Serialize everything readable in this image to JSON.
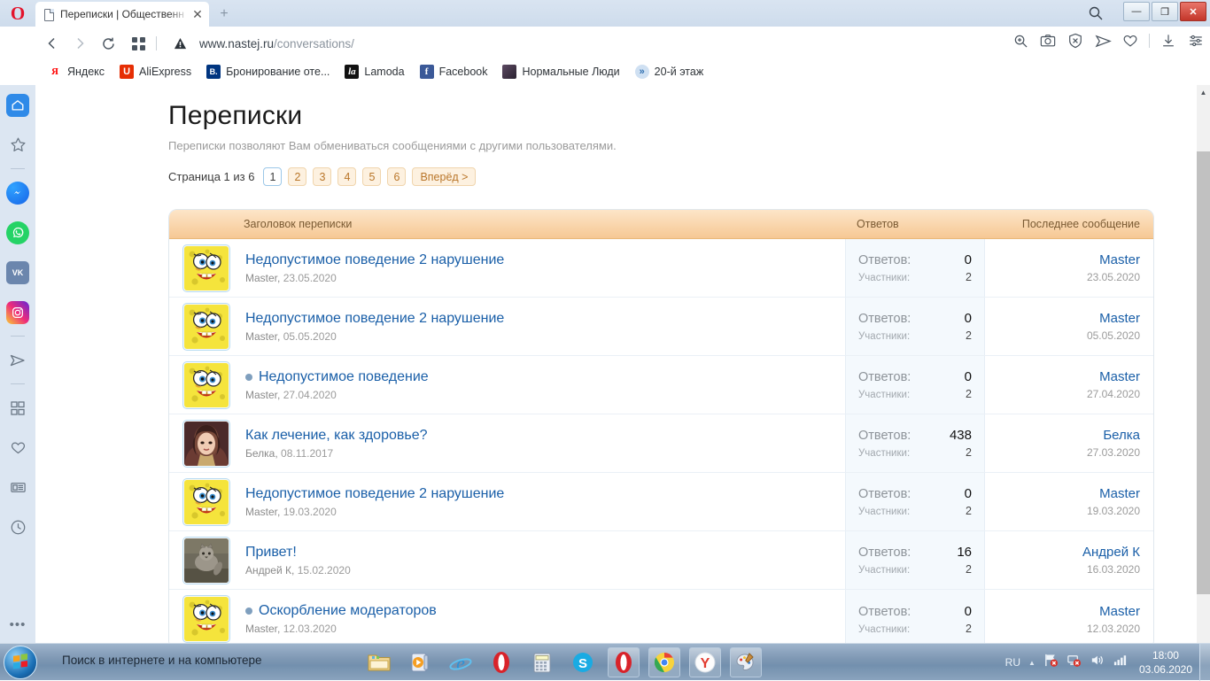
{
  "browser": {
    "name": "Opera",
    "tab": {
      "title": "Переписки | Общественн",
      "close_label": "✕"
    },
    "new_tab_label": "+",
    "address": {
      "url_prefix": "www.nastej.ru",
      "url_path": "/conversations/"
    },
    "nav": {
      "back": "‹",
      "forward": "›",
      "reload": "⟳",
      "speeddial": "⊞"
    },
    "window_controls": {
      "minimize": "—",
      "restore": "❐",
      "close": "✕"
    },
    "toolbar_icons": [
      "zoom-icon",
      "snapshot-icon",
      "adblock-shield-icon",
      "send-icon",
      "heart-icon",
      "download-icon",
      "easy-setup-icon"
    ],
    "bookmarks": [
      {
        "label": "Яндекс",
        "glyph": "Я",
        "color": "#ffffff",
        "text_color": "#ff0000"
      },
      {
        "label": "AliExpress",
        "glyph": "U",
        "color": "#e62e04",
        "text_color": "#ffffff"
      },
      {
        "label": "Бронирование оте...",
        "glyph": "B.",
        "color": "#003580",
        "text_color": "#ffffff"
      },
      {
        "label": "Lamoda",
        "glyph": "la",
        "color": "#111111",
        "text_color": "#ffffff"
      },
      {
        "label": "Facebook",
        "glyph": "f",
        "color": "#3b5998",
        "text_color": "#ffffff"
      },
      {
        "label": "Нормальные Люди",
        "glyph": "",
        "color": "#4a3a52",
        "text_color": "#ffffff"
      },
      {
        "label": "20-й этаж",
        "glyph": "»",
        "color": "#cfe0f2",
        "text_color": "#2f6fb0"
      }
    ],
    "sidebar_items": [
      {
        "name": "home",
        "label": "Главная",
        "active": true
      },
      {
        "name": "favorites",
        "label": "Закладки",
        "active": false
      },
      {
        "name": "messenger",
        "label": "Messenger",
        "active": false
      },
      {
        "name": "whatsapp",
        "label": "WhatsApp",
        "active": false
      },
      {
        "name": "vk",
        "label": "ВКонтакте",
        "active": false
      },
      {
        "name": "instagram",
        "label": "Instagram",
        "active": false
      },
      {
        "name": "telegram",
        "label": "Telegram",
        "active": false
      },
      {
        "name": "speed-dial",
        "label": "Экспресс-панель",
        "active": false
      },
      {
        "name": "heart",
        "label": "Избранное",
        "active": false
      },
      {
        "name": "news",
        "label": "Новости",
        "active": false
      },
      {
        "name": "history",
        "label": "История",
        "active": false
      },
      {
        "name": "more",
        "label": "Ещё",
        "active": false
      }
    ]
  },
  "page": {
    "title": "Переписки",
    "subtitle": "Переписки позволяют Вам обмениваться сообщениями с другими пользователями.",
    "pagination": {
      "label": "Страница 1 из 6",
      "pages": [
        "1",
        "2",
        "3",
        "4",
        "5",
        "6"
      ],
      "current": "1",
      "next_label": "Вперёд >"
    },
    "table": {
      "headers": {
        "title": "Заголовок переписки",
        "replies": "Ответов",
        "last": "Последнее сообщение"
      },
      "row_labels": {
        "replies": "Ответов:",
        "participants": "Участники:"
      },
      "rows": [
        {
          "avatar": "spongebob",
          "unread": false,
          "title": "Недопустимое поведение 2 нарушение",
          "author": "Master",
          "date": "23.05.2020",
          "replies": "0",
          "participants": "2",
          "last_user": "Master",
          "last_date": "23.05.2020"
        },
        {
          "avatar": "spongebob",
          "unread": false,
          "title": "Недопустимое поведение 2 нарушение",
          "author": "Master",
          "date": "05.05.2020",
          "replies": "0",
          "participants": "2",
          "last_user": "Master",
          "last_date": "05.05.2020"
        },
        {
          "avatar": "spongebob",
          "unread": true,
          "title": "Недопустимое поведение",
          "author": "Master",
          "date": "27.04.2020",
          "replies": "0",
          "participants": "2",
          "last_user": "Master",
          "last_date": "27.04.2020"
        },
        {
          "avatar": "girl",
          "unread": false,
          "title": "Как лечение, как здоровье?",
          "author": "Белка",
          "date": "08.11.2017",
          "replies": "438",
          "participants": "2",
          "last_user": "Белка",
          "last_date": "27.03.2020"
        },
        {
          "avatar": "spongebob",
          "unread": false,
          "title": "Недопустимое поведение 2 нарушение",
          "author": "Master",
          "date": "19.03.2020",
          "replies": "0",
          "participants": "2",
          "last_user": "Master",
          "last_date": "19.03.2020"
        },
        {
          "avatar": "cat",
          "unread": false,
          "title": "Привет!",
          "author": "Андрей К",
          "date": "15.02.2020",
          "replies": "16",
          "participants": "2",
          "last_user": "Андрей К",
          "last_date": "16.03.2020"
        },
        {
          "avatar": "spongebob",
          "unread": true,
          "title": "Оскорбление модераторов",
          "author": "Master",
          "date": "12.03.2020",
          "replies": "0",
          "participants": "2",
          "last_user": "Master",
          "last_date": "12.03.2020"
        }
      ]
    }
  },
  "taskbar": {
    "search_placeholder": "Поиск в интернете и на компьютере",
    "apps": [
      {
        "name": "explorer",
        "running": false
      },
      {
        "name": "media-player",
        "running": false
      },
      {
        "name": "internet-explorer",
        "running": false
      },
      {
        "name": "opera-pinned",
        "running": false
      },
      {
        "name": "calculator",
        "running": false
      },
      {
        "name": "skype",
        "running": false
      },
      {
        "name": "opera",
        "running": true
      },
      {
        "name": "chrome",
        "running": true
      },
      {
        "name": "yandex-browser",
        "running": true
      },
      {
        "name": "paint",
        "running": true
      }
    ],
    "tray": {
      "language": "RU",
      "time": "18:00",
      "date": "03.06.2020"
    }
  },
  "colors": {
    "accent_link": "#1a5fa8",
    "table_header_from": "#fde5c8",
    "table_header_to": "#f6c894",
    "pager_orange": "#b9762a",
    "chrome_blue": "#dce6f2"
  }
}
